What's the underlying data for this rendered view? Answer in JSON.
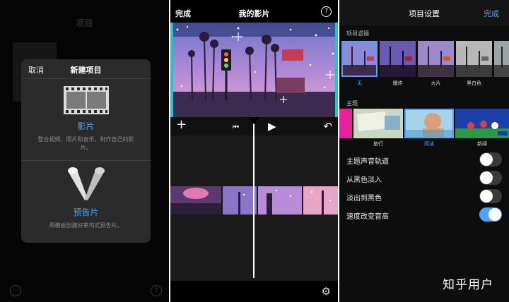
{
  "panel1": {
    "background_title": "项目",
    "sheet": {
      "cancel_label": "取消",
      "title": "新建项目",
      "movie": {
        "icon": "film-strip-icon",
        "label": "影片",
        "description": "整合视频、照片和音乐，制作自己的影片。"
      },
      "trailer": {
        "icon": "spotlight-icon",
        "label": "预告片",
        "description": "用模板创建好莱坞式预告片。"
      }
    },
    "footer_left_icon": "more-icon",
    "footer_right_icon": "help-icon",
    "help_glyph": "?",
    "more_glyph": "···"
  },
  "panel2": {
    "done_label": "完成",
    "title": "我的影片",
    "help_glyph": "?",
    "controls": {
      "add_glyph": "+",
      "skip_start_glyph": "⏮",
      "play_glyph": "▶",
      "undo_glyph": "↶"
    },
    "settings_glyph": "⚙"
  },
  "panel3": {
    "title": "项目设置",
    "done_label": "完成",
    "filters_section": "项目滤镜",
    "filters": [
      {
        "label": "无",
        "selected": true
      },
      {
        "label": "爆炸",
        "selected": false
      },
      {
        "label": "大片",
        "selected": false
      },
      {
        "label": "黑白色",
        "selected": false
      }
    ],
    "themes_section": "主题",
    "themes": [
      {
        "label": "旅行",
        "selected": false
      },
      {
        "label": "简洁",
        "selected": true
      },
      {
        "label": "新闻",
        "selected": false
      }
    ],
    "toggles": [
      {
        "label": "主题声音轨道",
        "on": false
      },
      {
        "label": "从黑色淡入",
        "on": false
      },
      {
        "label": "淡出到黑色",
        "on": false
      },
      {
        "label": "速度改变音高",
        "on": true
      }
    ]
  },
  "watermark": "知乎用户",
  "colors": {
    "accent": "#4da3ff",
    "background": "#000000",
    "sheet": "#2b2b2b"
  }
}
